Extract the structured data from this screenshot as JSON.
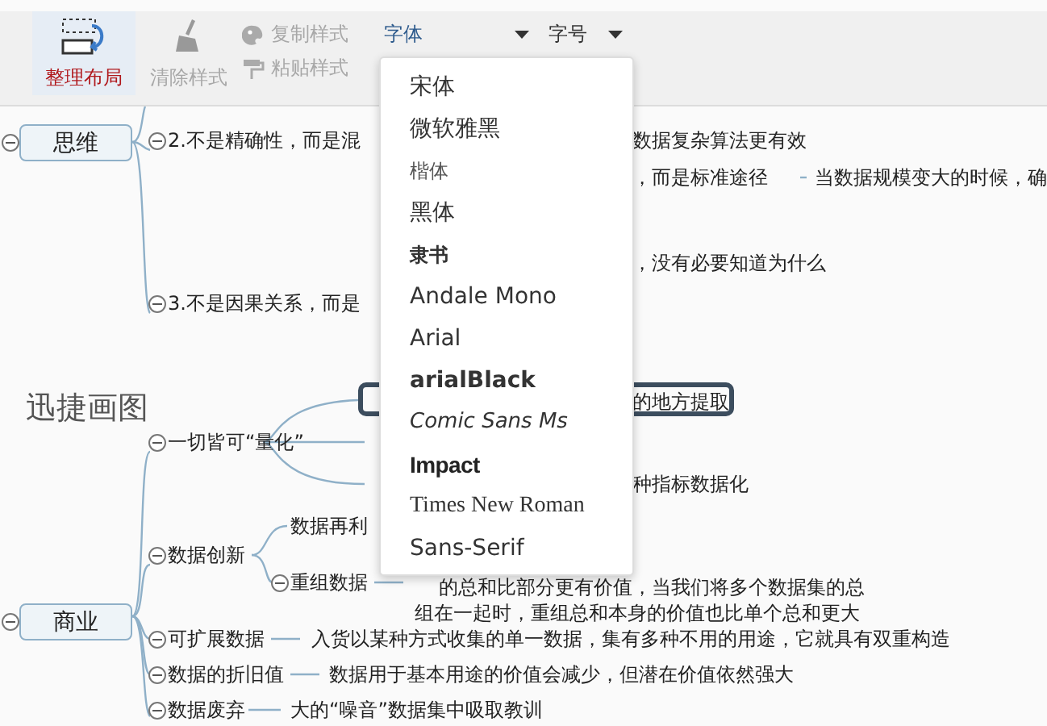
{
  "toolbar": {
    "buttons": [
      {
        "label": "整理布局",
        "disabled": false
      },
      {
        "label": "清除样式",
        "disabled": true
      },
      {
        "label": "复制样式",
        "disabled": true
      },
      {
        "label": "粘贴样式",
        "disabled": true
      }
    ],
    "font_select": {
      "label": "字体",
      "expanded": true
    },
    "size_select": {
      "label": "字号",
      "expanded": false
    }
  },
  "font_menu": {
    "options": [
      {
        "label": "宋体",
        "kind": "serif"
      },
      {
        "label": "微软雅黑",
        "kind": "sans"
      },
      {
        "label": "楷体",
        "kind": "script"
      },
      {
        "label": "黑体",
        "kind": "sans"
      },
      {
        "label": "隶书",
        "kind": "bold"
      },
      {
        "label": "Andale Mono",
        "kind": "sans"
      },
      {
        "label": "Arial",
        "kind": "sans"
      },
      {
        "label": "arialBlack",
        "kind": "black"
      },
      {
        "label": "Comic Sans Ms",
        "kind": "comic"
      },
      {
        "label": "Impact",
        "kind": "impact"
      },
      {
        "label": "Times New Roman",
        "kind": "times"
      },
      {
        "label": "Sans-Serif",
        "kind": "sans"
      }
    ]
  },
  "mindmap": {
    "items": [
      {
        "kind": "topic",
        "label": "思维",
        "expanded": true
      },
      {
        "kind": "branch",
        "label": "2.不是精确性，而是混",
        "expanded": true
      },
      {
        "kind": "note",
        "label": "数据复杂算法更有效"
      },
      {
        "kind": "note",
        "label": "，而是标准途径"
      },
      {
        "kind": "note",
        "label": "当数据规模变大的时候，确"
      },
      {
        "kind": "note",
        "label": "，没有必要知道为什么"
      },
      {
        "kind": "branch",
        "label": "3.不是因果关系，而是",
        "expanded": true
      },
      {
        "kind": "title",
        "label": "迅捷画图"
      },
      {
        "kind": "node",
        "label": "的地方提取",
        "selected": true
      },
      {
        "kind": "branch",
        "label": "一切皆可“量化”",
        "expanded": true
      },
      {
        "kind": "note",
        "label": "种指标数据化"
      },
      {
        "kind": "branch",
        "label": "数据创新",
        "expanded": true
      },
      {
        "kind": "note",
        "label": "数据再利"
      },
      {
        "kind": "branch",
        "label": "重组数据",
        "expanded": true
      },
      {
        "kind": "note",
        "label": "的总和比部分更有价值，当我们将多个数据集的总"
      },
      {
        "kind": "topic",
        "label": "商业",
        "expanded": true
      },
      {
        "kind": "note",
        "label": "组在一起时，重组总和本身的价值也比单个总和更大"
      },
      {
        "kind": "branch",
        "label": "可扩展数据",
        "expanded": true
      },
      {
        "kind": "note",
        "label": "入货以某种方式收集的单一数据，集有多种不用的用途，它就具有双重构造"
      },
      {
        "kind": "branch",
        "label": "数据的折旧值",
        "expanded": true
      },
      {
        "kind": "note",
        "label": "数据用于基本用途的价值会减少，但潜在价值依然强大"
      },
      {
        "kind": "branch",
        "label": "数据废弃",
        "expanded": true
      },
      {
        "kind": "note",
        "label": "大的“噪音”数据集中吸取教训"
      }
    ]
  }
}
